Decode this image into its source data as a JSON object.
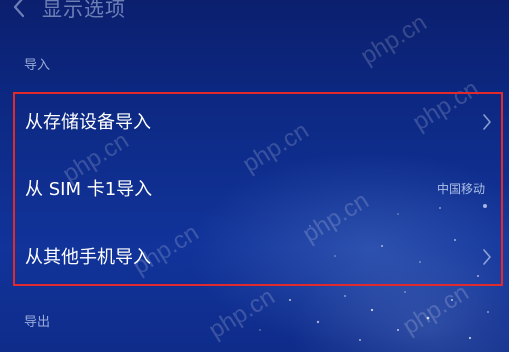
{
  "header": {
    "title": "显示选项",
    "back_icon": "back-arrow-icon"
  },
  "import_section": {
    "label": "导入",
    "items": [
      {
        "label": "从存储设备导入",
        "value": "",
        "icon": "chevron-right-icon"
      },
      {
        "label": "从 SIM 卡1导入",
        "value": "中国移动",
        "icon": ""
      },
      {
        "label": "从其他手机导入",
        "value": "",
        "icon": "chevron-right-icon"
      }
    ]
  },
  "export_section": {
    "label": "导出"
  },
  "highlight_color": "#e02a2e",
  "watermark": "php.cn"
}
